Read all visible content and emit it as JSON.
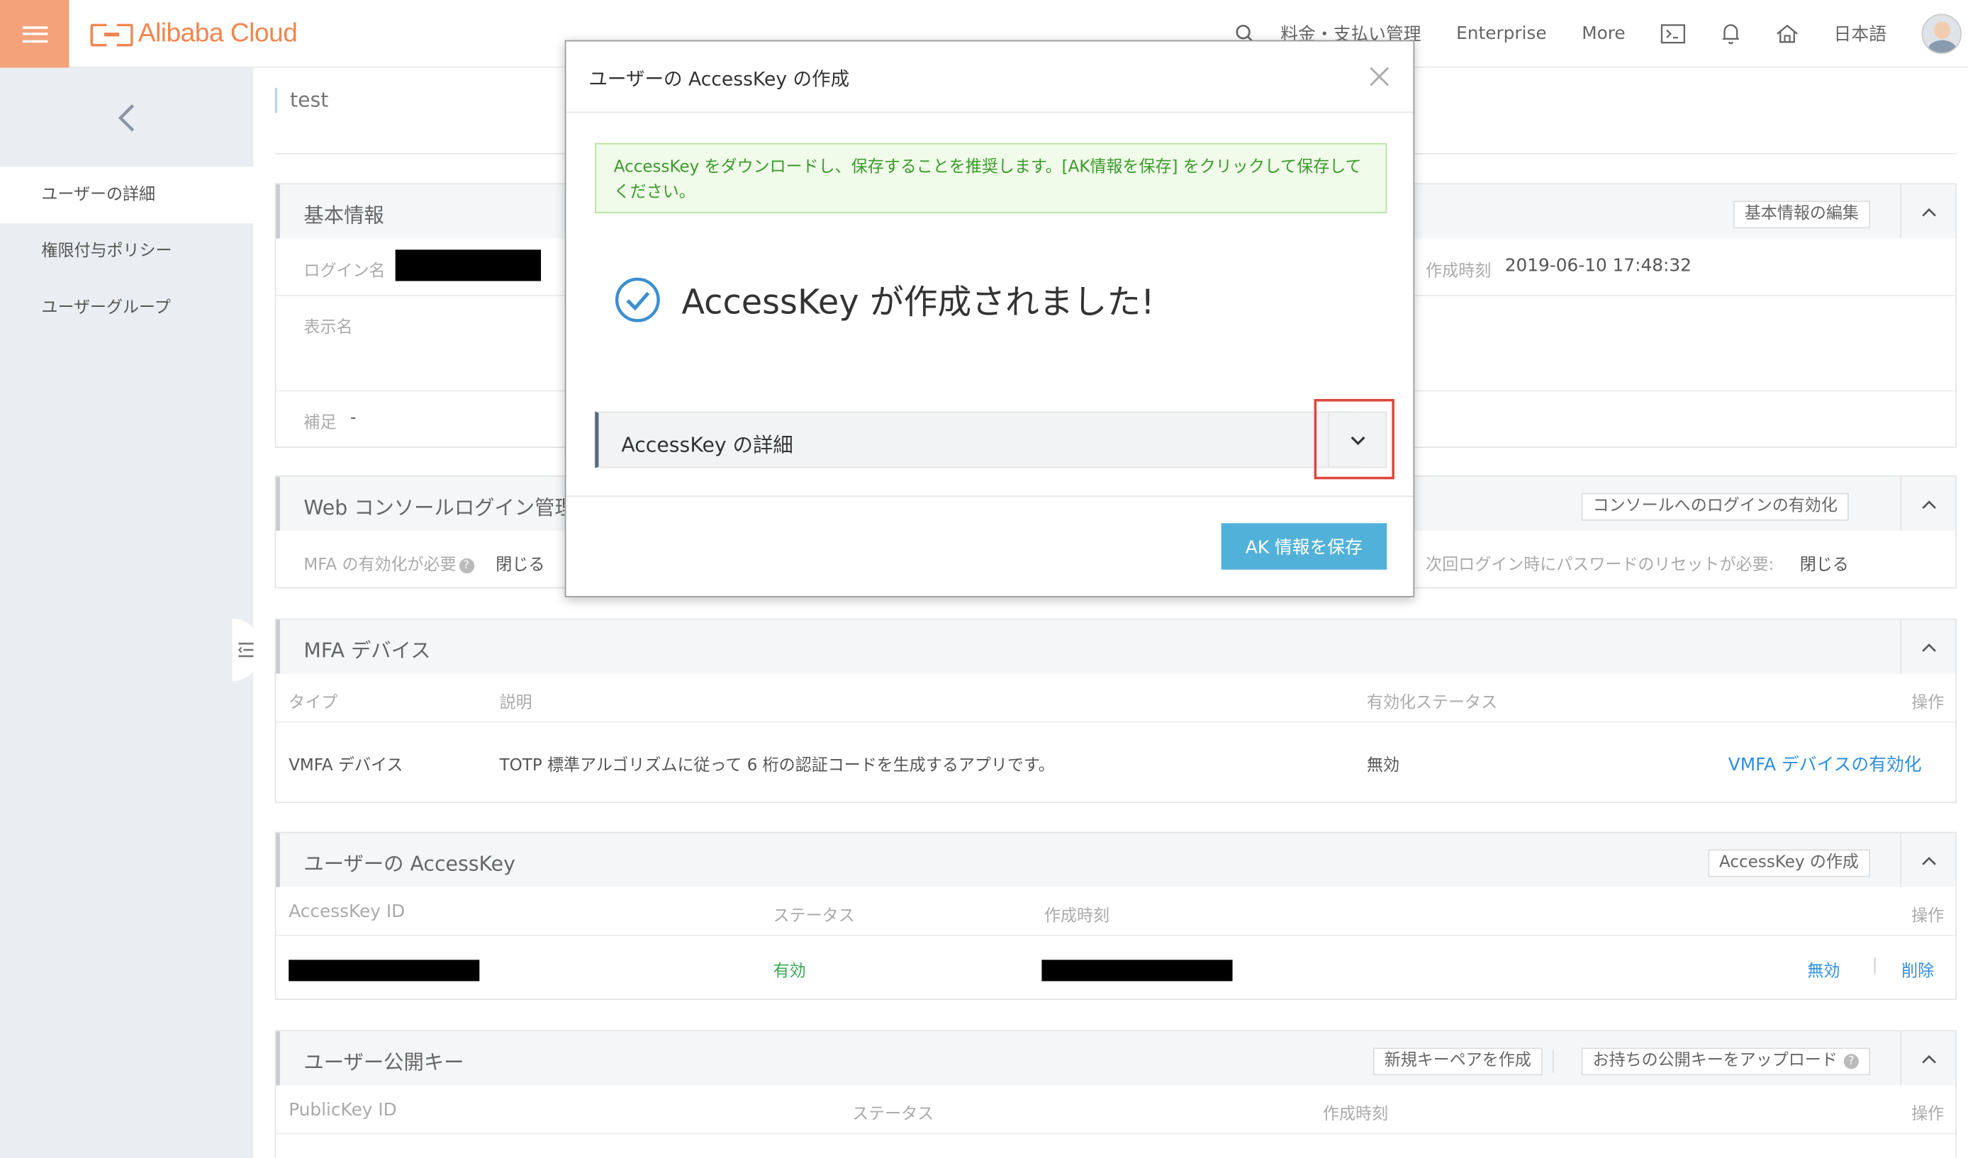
{
  "header": {
    "brand": "Alibaba Cloud",
    "nav": [
      "料金・支払い管理",
      "Enterprise",
      "More"
    ],
    "language": "日本語",
    "icons": [
      "search-icon",
      "terminal-icon",
      "bell-icon",
      "home-icon",
      "avatar"
    ]
  },
  "sidebar": {
    "items": [
      {
        "label": "ユーザーの詳細",
        "active": true
      },
      {
        "label": "権限付与ポリシー",
        "active": false
      },
      {
        "label": "ユーザーグループ",
        "active": false
      }
    ]
  },
  "page": {
    "title": "test"
  },
  "basic_info": {
    "title": "基本情報",
    "edit_button": "基本情報の編集",
    "login_name_label": "ログイン名",
    "display_name_label": "表示名",
    "note_label": "補足",
    "note_value": "-",
    "created_label": "作成時刻",
    "created_value": "2019-06-10 17:48:32"
  },
  "web_console": {
    "title": "Web コンソールログイン管理",
    "enable_button": "コンソールへのログインの有効化",
    "mfa_label": "MFA の有効化が必要",
    "mfa_value": "閉じる",
    "reset_label": "次回ログイン時にパスワードのリセットが必要:",
    "reset_value": "閉じる"
  },
  "mfa_device": {
    "title": "MFA デバイス",
    "columns": [
      "タイプ",
      "説明",
      "有効化ステータス",
      "操作"
    ],
    "row": {
      "type": "VMFA デバイス",
      "description": "TOTP 標準アルゴリズムに従って 6 桁の認証コードを生成するアプリです。",
      "status": "無効",
      "action": "VMFA デバイスの有効化"
    }
  },
  "access_key": {
    "title": "ユーザーの AccessKey",
    "create_button": "AccessKey の作成",
    "columns": [
      "AccessKey ID",
      "ステータス",
      "作成時刻",
      "操作"
    ],
    "row": {
      "status": "有効",
      "action_disable": "無効",
      "separator": "|",
      "action_delete": "削除"
    }
  },
  "public_key": {
    "title": "ユーザー公開キー",
    "new_button": "新規キーペアを作成",
    "upload_button": "お持ちの公開キーをアップロード",
    "columns": [
      "PublicKey ID",
      "ステータス",
      "作成時刻",
      "操作"
    ]
  },
  "modal": {
    "title": "ユーザーの AccessKey の作成",
    "notice": "AccessKey をダウンロードし、保存することを推奨します。[AK情報を保存] をクリックして保存してください。",
    "success": "AccessKey が作成されました!",
    "details_label": "AccessKey の詳細",
    "save_button": "AK 情報を保存"
  },
  "colors": {
    "brand": "#f08650",
    "menu_button": "#f3a27a",
    "link": "#2f8ee0",
    "success_green": "#3aa757",
    "primary_button": "#52b1d8",
    "highlight": "#e0463c"
  }
}
